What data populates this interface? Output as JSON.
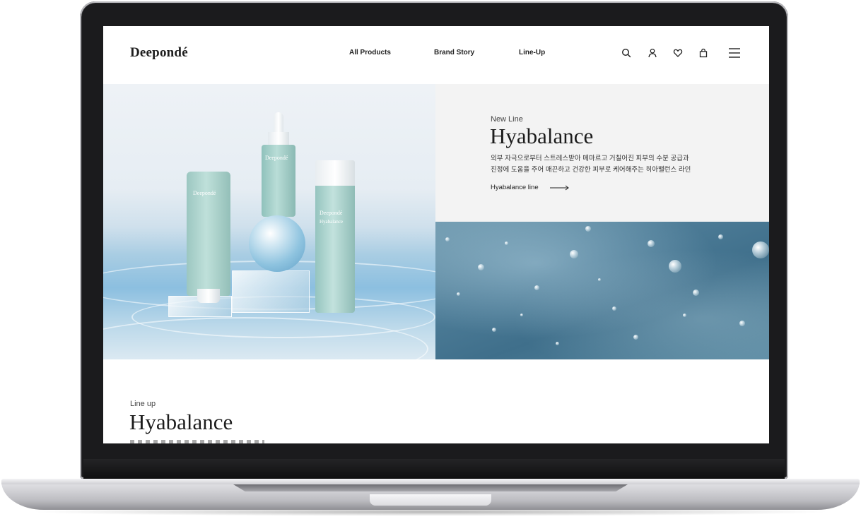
{
  "header": {
    "logo": "Deepondé",
    "nav": [
      "All Products",
      "Brand Story",
      "Line-Up"
    ],
    "icons": [
      "search-icon",
      "user-icon",
      "heart-icon",
      "bag-icon",
      "menu-icon"
    ]
  },
  "hero": {
    "eyebrow": "New Line",
    "title": "Hyabalance",
    "description_line1": "외부 자극으로부터 스트레스받아 메마르고 거칠어진 피부의 수분 공급과",
    "description_line2": "진정에 도움을 주어 매끈하고 건강한 피부로 케어해주는 히아밸런스 라인",
    "link": "Hyabalance line",
    "product_labels": {
      "tube": "Deepondé",
      "serum": "Deepondé",
      "toner": "Deepondé",
      "toner_sub": "Hyabalance"
    }
  },
  "lineup": {
    "eyebrow": "Line up",
    "title": "Hyabalance"
  },
  "colors": {
    "text": "#1c1c1c",
    "info_bg": "#f3f3f3",
    "water": "#4d7c97",
    "product_mint": "#a9d2cc"
  }
}
